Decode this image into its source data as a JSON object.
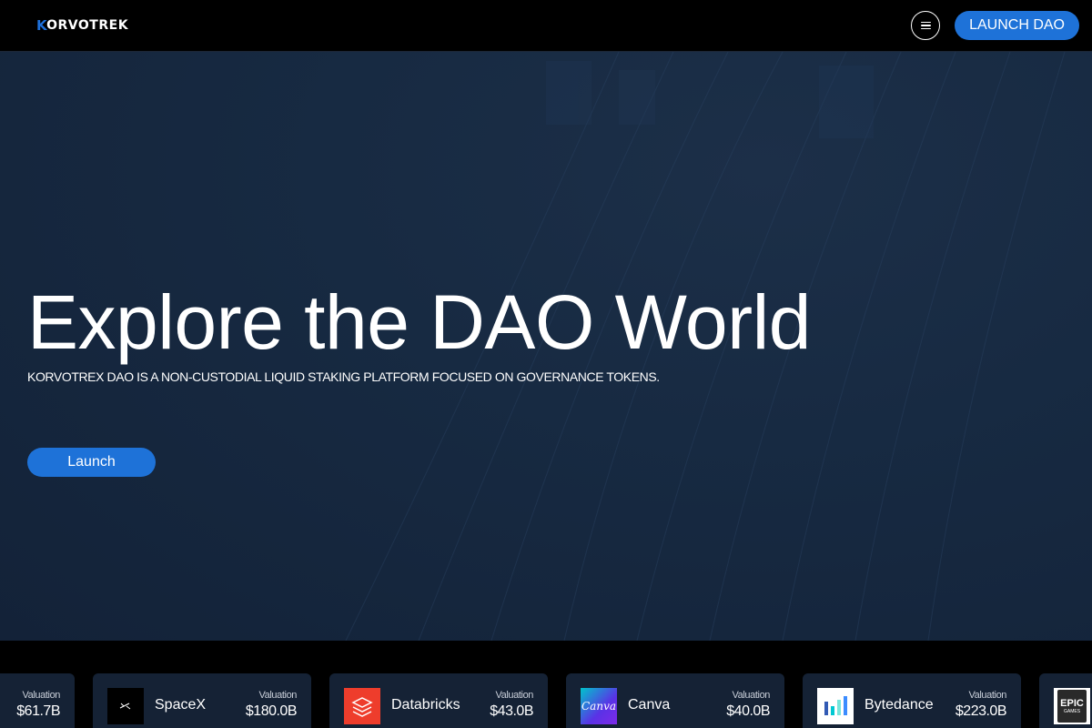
{
  "header": {
    "logo_mark": "K",
    "logo_text": "ORVOTREK",
    "menu_icon": "hamburger-menu-icon",
    "launch_button": "LAUNCH DAO"
  },
  "hero": {
    "title": "Explore the DAO World",
    "subtitle": "KORVOTREX DAO IS A NON-CUSTODIAL LIQUID STAKING PLATFORM FOCUSED ON GOVERNANCE TOKENS.",
    "launch_button": "Launch"
  },
  "colors": {
    "accent": "#1e72d8",
    "hero_bg": "#172a42",
    "card_bg": "#152235"
  },
  "companies": [
    {
      "name": "",
      "valuation_label": "Valuation",
      "valuation": "$61.7B",
      "icon": ""
    },
    {
      "name": "SpaceX",
      "valuation_label": "Valuation",
      "valuation": "$180.0B",
      "icon": "spacex-logo-icon"
    },
    {
      "name": "Databricks",
      "valuation_label": "Valuation",
      "valuation": "$43.0B",
      "icon": "databricks-logo-icon"
    },
    {
      "name": "Canva",
      "valuation_label": "Valuation",
      "valuation": "$40.0B",
      "icon": "canva-logo-icon",
      "logo_text": "Canva"
    },
    {
      "name": "Bytedance",
      "valuation_label": "Valuation",
      "valuation": "$223.0B",
      "icon": "bytedance-logo-icon"
    },
    {
      "name": "",
      "valuation_label": "",
      "valuation": "",
      "icon": "epic-games-logo-icon",
      "logo_text": "EPIC",
      "logo_subtext": "GAMES"
    }
  ]
}
